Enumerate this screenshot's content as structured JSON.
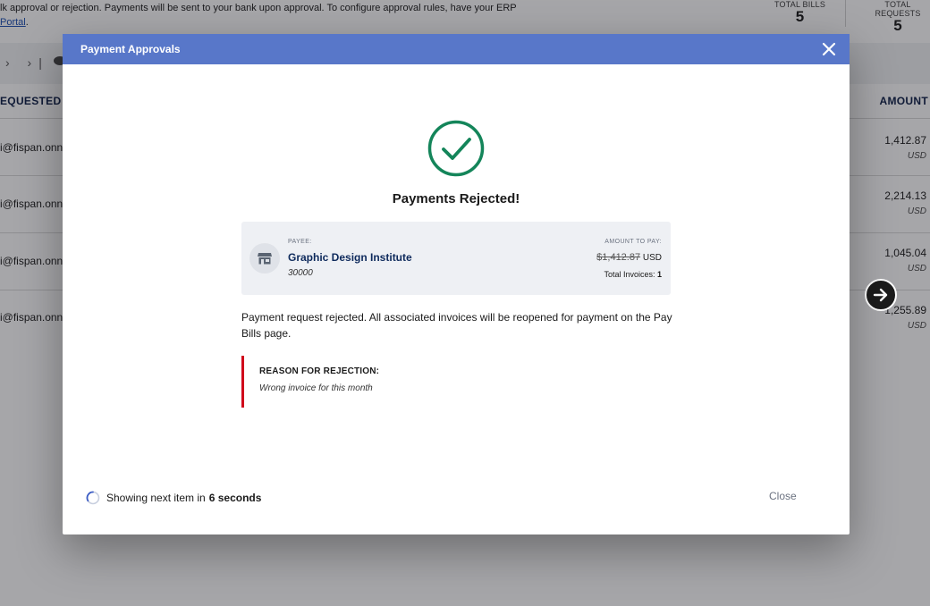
{
  "background": {
    "description": "lk approval or rejection. Payments will be sent to your bank upon approval. To configure approval rules, have your ERP",
    "description_link": "Portal",
    "stats": [
      {
        "label": "TOTAL BILLS",
        "value": "5"
      },
      {
        "label": "TOTAL REQUESTS",
        "value": "5"
      }
    ],
    "columns": {
      "requested_by": "EQUESTED B",
      "amount": "AMOUNT"
    },
    "rows": [
      {
        "email": "i@fispan.onn",
        "amount": "1,412.87",
        "currency": "USD"
      },
      {
        "email": "i@fispan.onn",
        "amount": "2,214.13",
        "currency": "USD"
      },
      {
        "email": "i@fispan.onn",
        "amount": "1,045.04",
        "currency": "USD"
      },
      {
        "email": "i@fispan.onn",
        "amount": "1,255.89",
        "currency": "USD"
      }
    ]
  },
  "modal": {
    "title": "Payment Approvals",
    "result_title": "Payments Rejected!",
    "payee": {
      "label": "PAYEE:",
      "name": "Graphic Design Institute",
      "id": "30000"
    },
    "amount": {
      "label": "AMOUNT TO PAY:",
      "value": "$1,412.87",
      "currency": "USD",
      "total_invoices_label": "Total Invoices:",
      "total_invoices": "1"
    },
    "message": "Payment request rejected. All associated invoices will be reopened for payment on the Pay Bills page.",
    "reason": {
      "label": "REASON FOR REJECTION:",
      "text": "Wrong invoice for this month"
    },
    "footer": {
      "countdown_prefix": "Showing next item in",
      "countdown_value": "6 seconds",
      "close_label": "Close"
    }
  },
  "colors": {
    "header": "#5877c9",
    "success": "#14855a",
    "reason_bar": "#d0021b",
    "payee_name": "#0e2a5c"
  },
  "icons": {
    "success": "check-circle-icon",
    "payee": "storefront-icon",
    "close": "close-icon",
    "next": "arrow-right-icon",
    "loading": "spinner-icon"
  }
}
